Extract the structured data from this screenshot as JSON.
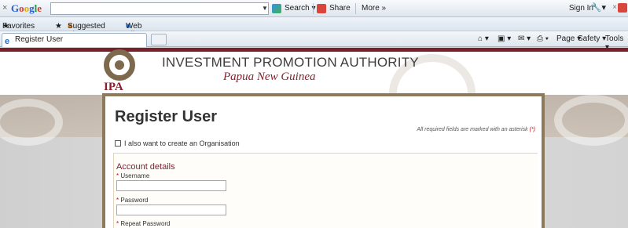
{
  "toolbar": {
    "close": "×",
    "google_logo": "Google",
    "search_btn": "Search",
    "share_btn": "Share",
    "more_btn": "More »",
    "signin": "Sign In"
  },
  "favorites": {
    "label": "Favorites",
    "suggested": "Suggested Sites ▾",
    "webslice": "Web Slice Gallery ▾"
  },
  "tab": {
    "title": "Register User"
  },
  "commands": {
    "page": "Page ▾",
    "safety": "Safety ▾",
    "tools": "Tools ▾"
  },
  "header": {
    "org_name": "INVESTMENT PROMOTION AUTHORITY",
    "org_sub": "Papua New Guinea",
    "logo_text": "IPA"
  },
  "form": {
    "title": "Register User",
    "required_note": "All required fields are marked with an asterisk",
    "required_marker": "(*)",
    "org_checkbox_label": "I also want to create an Organisation",
    "section_title": "Account details",
    "asterisk": "*",
    "username_label": "Username",
    "password_label": "Password",
    "repeat_password_label": "Repeat Password"
  }
}
